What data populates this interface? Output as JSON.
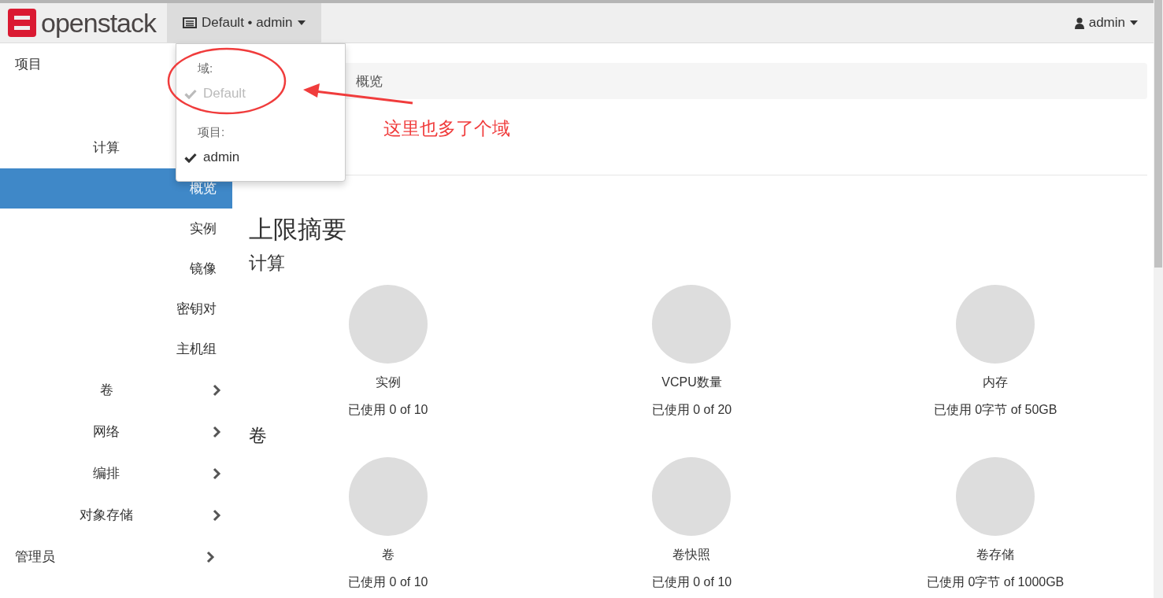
{
  "header": {
    "brand": "openstack",
    "context_button": "Default • admin",
    "user_menu": "admin"
  },
  "context_menu": {
    "sections": [
      {
        "header": "域:",
        "items": [
          {
            "label": "Default",
            "checked": true,
            "disabled": true
          }
        ]
      },
      {
        "header": "项目:",
        "items": [
          {
            "label": "admin",
            "checked": true,
            "disabled": false
          }
        ]
      }
    ]
  },
  "sidebar": {
    "items": [
      {
        "label": "项目",
        "children": [
          {
            "label": "计算",
            "children": [
              {
                "label": "概览",
                "selected": true
              },
              {
                "label": "实例",
                "selected": false
              },
              {
                "label": "镜像",
                "selected": false
              },
              {
                "label": "密钥对",
                "selected": false
              },
              {
                "label": "主机组",
                "selected": false
              }
            ]
          },
          {
            "label": "卷",
            "expanded": false
          },
          {
            "label": "网络",
            "expanded": false
          },
          {
            "label": "编排",
            "expanded": false
          },
          {
            "label": "对象存储",
            "expanded": false
          }
        ]
      },
      {
        "label": "管理员",
        "expanded": false
      }
    ]
  },
  "breadcrumb": [
    "概览"
  ],
  "page_title": "上限摘要",
  "sections": [
    {
      "title": "计算",
      "quotas": [
        {
          "name": "实例",
          "usage": "已使用 0 of 10"
        },
        {
          "name": "VCPU数量",
          "usage": "已使用 0 of 20"
        },
        {
          "name": "内存",
          "usage": "已使用 0字节 of 50GB"
        }
      ]
    },
    {
      "title": "卷",
      "quotas": [
        {
          "name": "卷",
          "usage": "已使用 0 of 10"
        },
        {
          "name": "卷快照",
          "usage": "已使用 0 of 10"
        },
        {
          "name": "卷存储",
          "usage": "已使用 0字节 of 1000GB"
        }
      ]
    }
  ],
  "annotation": {
    "text": "这里也多了个域"
  }
}
